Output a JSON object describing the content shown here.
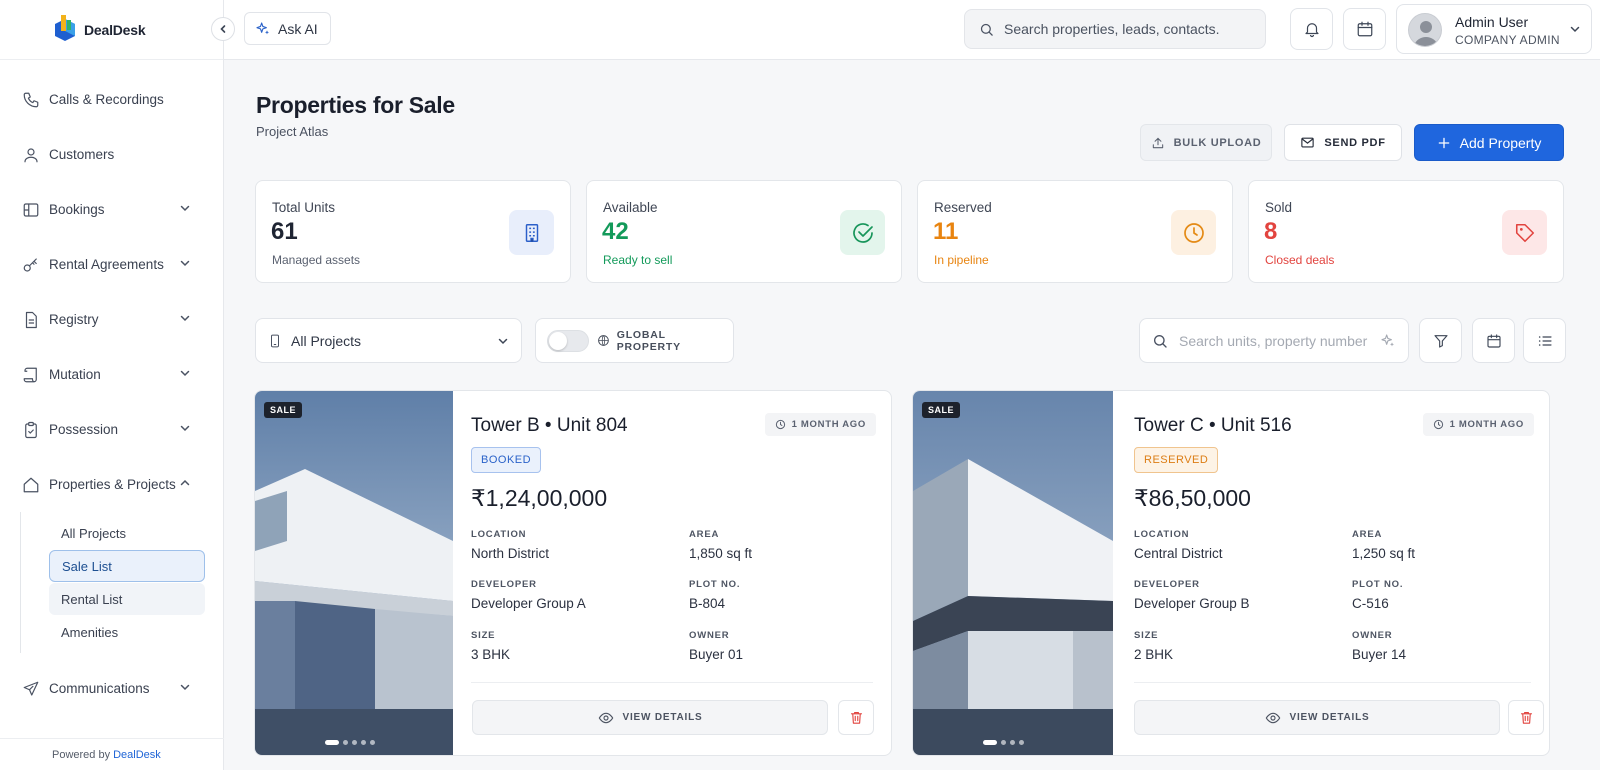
{
  "brand": {
    "name": "DealDesk"
  },
  "topbar": {
    "ask_ai": "Ask AI",
    "search_placeholder": "Search properties, leads, contacts.",
    "user_name": "Admin User",
    "user_role": "COMPANY ADMIN"
  },
  "sidebar": {
    "items": [
      {
        "label": "Calls & Recordings",
        "icon": "phone-icon"
      },
      {
        "label": "Customers",
        "icon": "user-icon"
      },
      {
        "label": "Bookings",
        "icon": "booking-icon"
      },
      {
        "label": "Rental Agreements",
        "icon": "key-icon"
      },
      {
        "label": "Registry",
        "icon": "document-icon"
      },
      {
        "label": "Mutation",
        "icon": "scroll-icon"
      },
      {
        "label": "Possession",
        "icon": "clipboard-check-icon"
      },
      {
        "label": "Properties & Projects",
        "icon": "home-icon"
      },
      {
        "label": "Communications",
        "icon": "send-icon"
      }
    ],
    "sub_items": [
      "All Projects",
      "Sale List",
      "Rental List",
      "Amenities"
    ],
    "footer_text": "Powered by",
    "footer_brand": "DealDesk"
  },
  "page": {
    "title": "Properties for Sale",
    "subtitle": "Project Atlas",
    "bulk_upload": "BULK UPLOAD",
    "send_pdf": "SEND PDF",
    "add_property": "Add Property"
  },
  "stats": [
    {
      "label": "Total Units",
      "value": "61",
      "note": "Managed assets",
      "color": "#1f2533",
      "note_color": "#5a6170",
      "icon_bg": "#e8eefb",
      "icon_color": "#2b5fc9",
      "icon": "building-icon"
    },
    {
      "label": "Available",
      "value": "42",
      "note": "Ready to sell",
      "color": "#139a5a",
      "note_color": "#139a5a",
      "icon_bg": "#e3f5ec",
      "icon_color": "#17955a",
      "icon": "check-circle-icon"
    },
    {
      "label": "Reserved",
      "value": "11",
      "note": "In pipeline",
      "color": "#e88410",
      "note_color": "#e88410",
      "icon_bg": "#fdf0e1",
      "icon_color": "#e48a15",
      "icon": "clock-icon"
    },
    {
      "label": "Sold",
      "value": "8",
      "note": "Closed deals",
      "color": "#e2443f",
      "note_color": "#e2443f",
      "icon_bg": "#fde7e7",
      "icon_color": "#e2443f",
      "icon": "tag-icon"
    }
  ],
  "filters": {
    "project_select": "All Projects",
    "global_property": "GLOBAL PROPERTY",
    "unit_search_placeholder": "Search units, property number"
  },
  "cards": [
    {
      "tag": "SALE",
      "title": "Tower B • Unit 804",
      "time": "1 MONTH AGO",
      "status": "BOOKED",
      "status_color": "#2a62c9",
      "status_bg": "#eaf1fc",
      "status_border": "#a7c2ee",
      "price": "₹1,24,00,000",
      "fields": [
        {
          "label": "LOCATION",
          "value": "North District"
        },
        {
          "label": "AREA",
          "value": "1,850 sq ft"
        },
        {
          "label": "DEVELOPER",
          "value": "Developer Group A"
        },
        {
          "label": "PLOT NO.",
          "value": "B-804"
        },
        {
          "label": "SIZE",
          "value": "3 BHK"
        },
        {
          "label": "OWNER",
          "value": "Buyer 01"
        }
      ],
      "view": "VIEW DETAILS"
    },
    {
      "tag": "SALE",
      "title": "Tower C • Unit 516",
      "time": "1 MONTH AGO",
      "status": "RESERVED",
      "status_color": "#dc7d14",
      "status_bg": "#fdf3e6",
      "status_border": "#f0c48e",
      "price": "₹86,50,000",
      "fields": [
        {
          "label": "LOCATION",
          "value": "Central District"
        },
        {
          "label": "AREA",
          "value": "1,250 sq ft"
        },
        {
          "label": "DEVELOPER",
          "value": "Developer Group B"
        },
        {
          "label": "PLOT NO.",
          "value": "C-516"
        },
        {
          "label": "SIZE",
          "value": "2 BHK"
        },
        {
          "label": "OWNER",
          "value": "Buyer 14"
        }
      ],
      "view": "VIEW DETAILS"
    }
  ]
}
